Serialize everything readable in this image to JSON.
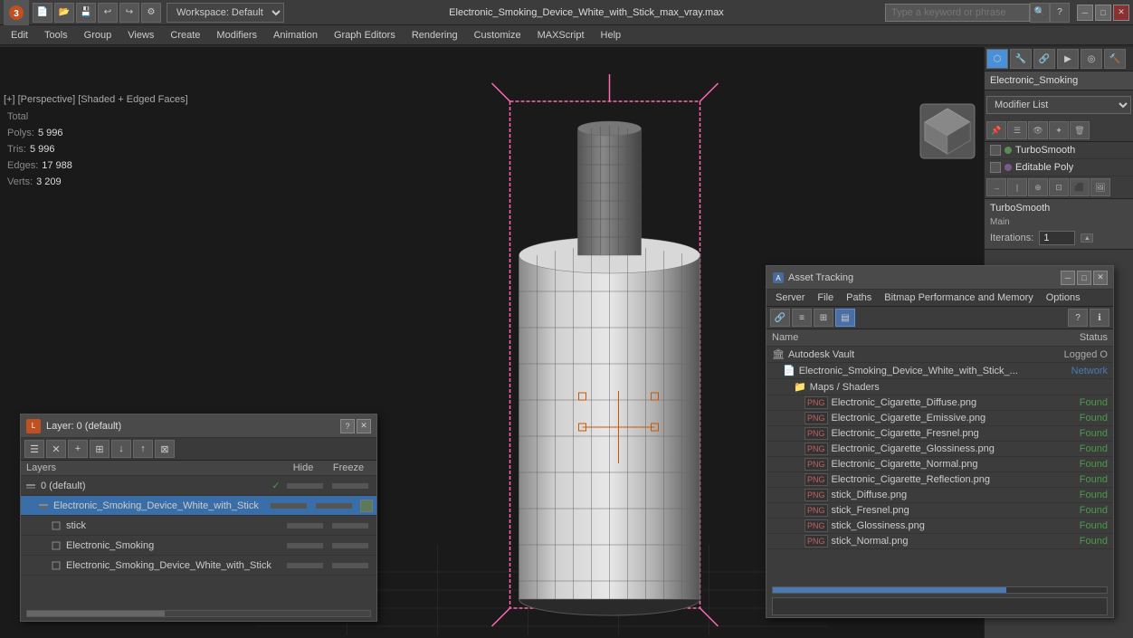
{
  "title": "Electronic_Smoking_Device_White_with_Stick_max_vray.max",
  "topbar": {
    "workspace": "Workspace: Default",
    "search_placeholder": "Type a keyword or phrase"
  },
  "menubar": {
    "items": [
      "Edit",
      "Tools",
      "Group",
      "Views",
      "Create",
      "Modifiers",
      "Animation",
      "Graph Editors",
      "Rendering",
      "Customize",
      "MAXScript",
      "Help"
    ]
  },
  "viewport": {
    "label": "[+] [Perspective] [Shaded + Edged Faces]",
    "stats": {
      "polys_label": "Polys:",
      "polys_value": "5 996",
      "tris_label": "Tris:",
      "tris_value": "5 996",
      "edges_label": "Edges:",
      "edges_value": "17 988",
      "verts_label": "Verts:",
      "verts_value": "3 209",
      "total_label": "Total"
    }
  },
  "modifier_panel": {
    "name": "Electronic_Smoking",
    "modifier_list_label": "Modifier List",
    "modifiers": [
      {
        "name": "TurboSmooth",
        "enabled": true
      },
      {
        "name": "Editable Poly",
        "enabled": true
      }
    ],
    "turbosmooth": {
      "title": "TurboSmooth",
      "main_label": "Main",
      "iterations_label": "Iterations:",
      "iterations_value": "1"
    }
  },
  "asset_tracking": {
    "title": "Asset Tracking",
    "menu": [
      "Server",
      "File",
      "Paths",
      "Bitmap Performance and Memory",
      "Options"
    ],
    "columns": {
      "name": "Name",
      "status": "Status"
    },
    "rows": [
      {
        "name": "Autodesk Vault",
        "indent": 0,
        "status": "Logged O",
        "status_type": "logged",
        "icon": "vault"
      },
      {
        "name": "Electronic_Smoking_Device_White_with_Stick_...",
        "indent": 1,
        "status": "Network",
        "status_type": "network",
        "icon": "file"
      },
      {
        "name": "Maps / Shaders",
        "indent": 2,
        "status": "",
        "status_type": "",
        "icon": "folder"
      },
      {
        "name": "Electronic_Cigarette_Diffuse.png",
        "indent": 3,
        "status": "Found",
        "status_type": "found",
        "icon": "png"
      },
      {
        "name": "Electronic_Cigarette_Emissive.png",
        "indent": 3,
        "status": "Found",
        "status_type": "found",
        "icon": "png"
      },
      {
        "name": "Electronic_Cigarette_Fresnel.png",
        "indent": 3,
        "status": "Found",
        "status_type": "found",
        "icon": "png"
      },
      {
        "name": "Electronic_Cigarette_Glossiness.png",
        "indent": 3,
        "status": "Found",
        "status_type": "found",
        "icon": "png"
      },
      {
        "name": "Electronic_Cigarette_Normal.png",
        "indent": 3,
        "status": "Found",
        "status_type": "found",
        "icon": "png"
      },
      {
        "name": "Electronic_Cigarette_Reflection.png",
        "indent": 3,
        "status": "Found",
        "status_type": "found",
        "icon": "png"
      },
      {
        "name": "stick_Diffuse.png",
        "indent": 3,
        "status": "Found",
        "status_type": "found",
        "icon": "png"
      },
      {
        "name": "stick_Fresnel.png",
        "indent": 3,
        "status": "Found",
        "status_type": "found",
        "icon": "png"
      },
      {
        "name": "stick_Glossiness.png",
        "indent": 3,
        "status": "Found",
        "status_type": "found",
        "icon": "png"
      },
      {
        "name": "stick_Normal.png",
        "indent": 3,
        "status": "Found",
        "status_type": "found",
        "icon": "png"
      }
    ]
  },
  "layer_window": {
    "title": "Layer: 0 (default)",
    "toolbar_buttons": [
      "layers",
      "delete",
      "add",
      "duplicate",
      "merge-down",
      "merge-up",
      "split"
    ],
    "columns": {
      "name": "Layers",
      "hide": "Hide",
      "freeze": "Freeze"
    },
    "items": [
      {
        "name": "0 (default)",
        "indent": 0,
        "selected": false,
        "has_check": true,
        "icon": "layer"
      },
      {
        "name": "Electronic_Smoking_Device_White_with_Stick",
        "indent": 1,
        "selected": true,
        "has_check": false,
        "has_box": true,
        "icon": "layer-active"
      },
      {
        "name": "stick",
        "indent": 2,
        "selected": false,
        "has_check": false,
        "icon": "object"
      },
      {
        "name": "Electronic_Smoking",
        "indent": 2,
        "selected": false,
        "has_check": false,
        "icon": "object"
      },
      {
        "name": "Electronic_Smoking_Device_White_with_Stick",
        "indent": 2,
        "selected": false,
        "has_check": false,
        "icon": "object"
      }
    ]
  },
  "icons": {
    "close": "✕",
    "minimize": "─",
    "maximize": "□",
    "question": "?",
    "check": "✓"
  }
}
